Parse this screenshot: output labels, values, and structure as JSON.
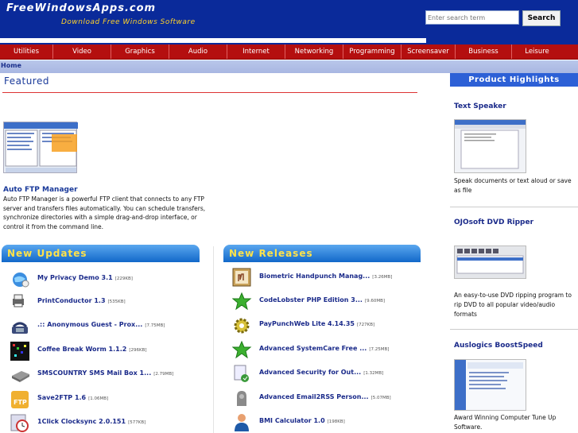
{
  "header": {
    "logo": "FreeWindowsApps.com",
    "tagline": "Download Free Windows Software",
    "search_placeholder": "Enter search term",
    "search_button": "Search"
  },
  "nav": [
    "Utilities",
    "Video",
    "Graphics",
    "Audio",
    "Internet",
    "Networking",
    "Programming",
    "Screensaver",
    "Business",
    "Leisure"
  ],
  "breadcrumb": "Home",
  "featured": {
    "title": "Featured",
    "name": "Auto FTP Manager",
    "description": "Auto FTP Manager is a powerful FTP client that connects to any FTP server and transfers files automatically. You can schedule transfers, synchronize directories with a simple drag-and-drop interface, or control it from the command line."
  },
  "updates": {
    "title": "New Updates",
    "items": [
      {
        "name": "My Privacy Demo 3.1",
        "size": "[229KB]",
        "icon": "privacy-globe-icon"
      },
      {
        "name": "PrintConductor 1.3",
        "size": "[535KB]",
        "icon": "printer-icon"
      },
      {
        "name": ".:: Anonymous Guest - Prox...",
        "size": "[7.75MB]",
        "icon": "phone-icon"
      },
      {
        "name": "Coffee Break Worm 1.1.2",
        "size": "[296KB]",
        "icon": "worm-game-icon"
      },
      {
        "name": "SMSCOUNTRY SMS Mail Box 1...",
        "size": "[2.79MB]",
        "icon": "sms-device-icon"
      },
      {
        "name": "Save2FTP 1.6",
        "size": "[1.06MB]",
        "icon": "ftp-folder-icon"
      },
      {
        "name": "1Click Clocksync 2.0.151",
        "size": "[577KB]",
        "icon": "clock-icon"
      }
    ]
  },
  "releases": {
    "title": "New Releases",
    "items": [
      {
        "name": "Biometric Handpunch Manag...",
        "size": "[3.26MB]",
        "icon": "handpunch-icon"
      },
      {
        "name": "CodeLobster PHP Edition 3...",
        "size": "[9.60MB]",
        "icon": "green-star-icon"
      },
      {
        "name": "PayPunchWeb Lite 4.14.35",
        "size": "[727KB]",
        "icon": "gear-icon"
      },
      {
        "name": "Advanced SystemCare Free ...",
        "size": "[7.25MB]",
        "icon": "green-star-icon"
      },
      {
        "name": "Advanced Security for Out...",
        "size": "[1.32MB]",
        "icon": "security-icon"
      },
      {
        "name": "Advanced Email2RSS Person...",
        "size": "[5.07MB]",
        "icon": "email-rss-icon"
      },
      {
        "name": "BMI Calculator 1.0",
        "size": "[198KB]",
        "icon": "person-icon"
      }
    ]
  },
  "highlights": {
    "title": "Product Highlights",
    "items": [
      {
        "name": "Text Speaker",
        "description": "Speak documents or text aloud or save as file"
      },
      {
        "name": "OJOsoft DVD Ripper",
        "description": "An easy-to-use DVD ripping program to rip DVD to all popular video/audio formats"
      },
      {
        "name": "Auslogics BoostSpeed",
        "description": "Award Winning Computer Tune Up Software."
      }
    ]
  },
  "colors": {
    "header_bg": "#0a2a9a",
    "tagline": "#ffd22a",
    "nav_bg": "#b40f0f",
    "section_head_text": "#ffe24a",
    "link": "#1a2a8a"
  }
}
